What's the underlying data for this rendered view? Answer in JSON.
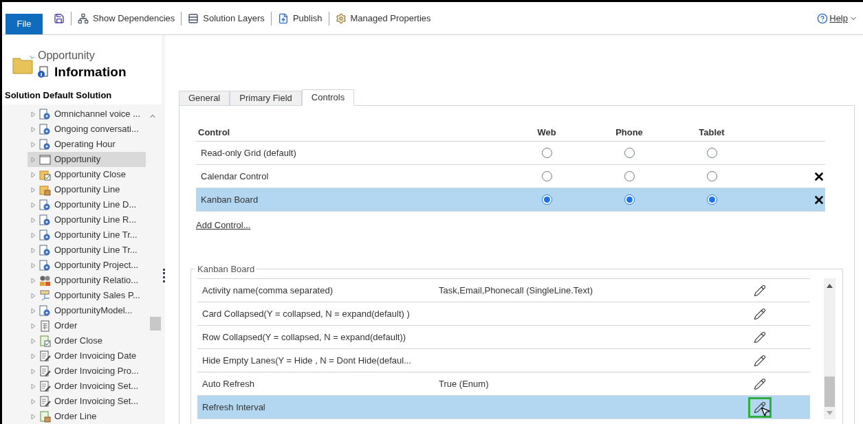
{
  "toolbar": {
    "file_tab": "File",
    "items": [
      {
        "kind": "save"
      },
      {
        "kind": "dependencies",
        "label": "Show Dependencies"
      },
      {
        "kind": "layers",
        "label": "Solution Layers"
      },
      {
        "kind": "publish",
        "label": "Publish"
      },
      {
        "kind": "properties",
        "label": "Managed Properties"
      }
    ],
    "help": "Help"
  },
  "entity_header": {
    "entity": "Opportunity",
    "title": "Information"
  },
  "sidebar": {
    "solution_label": "Solution Default Solution",
    "items": [
      {
        "label": "Omnichannel voice ...",
        "kind": "gear",
        "selected": false
      },
      {
        "label": "Ongoing conversati...",
        "kind": "gear",
        "selected": false
      },
      {
        "label": "Operating Hour",
        "kind": "gear",
        "selected": false
      },
      {
        "label": "Opportunity",
        "kind": "blank",
        "selected": true
      },
      {
        "label": "Opportunity Close",
        "kind": "folder-check",
        "selected": false
      },
      {
        "label": "Opportunity Line",
        "kind": "folder-box",
        "selected": false
      },
      {
        "label": "Opportunity Line D...",
        "kind": "gear",
        "selected": false
      },
      {
        "label": "Opportunity Line R...",
        "kind": "gear",
        "selected": false
      },
      {
        "label": "Opportunity Line Tr...",
        "kind": "gear",
        "selected": false
      },
      {
        "label": "Opportunity Line Tr...",
        "kind": "gear",
        "selected": false
      },
      {
        "label": "Opportunity Project...",
        "kind": "gear",
        "selected": false
      },
      {
        "label": "Opportunity Relatio...",
        "kind": "people",
        "selected": false
      },
      {
        "label": "Opportunity Sales P...",
        "kind": "flow",
        "selected": false
      },
      {
        "label": "OpportunityModel...",
        "kind": "gear",
        "selected": false
      },
      {
        "label": "Order",
        "kind": "doc",
        "selected": false
      },
      {
        "label": "Order Close",
        "kind": "doc-check",
        "selected": false
      },
      {
        "label": "Order Invoicing Date",
        "kind": "doc-edit",
        "selected": false
      },
      {
        "label": "Order Invoicing Pro...",
        "kind": "doc-edit",
        "selected": false
      },
      {
        "label": "Order Invoicing Set...",
        "kind": "doc-edit",
        "selected": false
      },
      {
        "label": "Order Invoicing Set...",
        "kind": "doc-edit",
        "selected": false
      },
      {
        "label": "Order Line",
        "kind": "doc-box",
        "selected": false
      }
    ]
  },
  "tabs": [
    {
      "label": "General",
      "selected": false
    },
    {
      "label": "Primary Field",
      "selected": false
    },
    {
      "label": "Controls",
      "selected": true
    }
  ],
  "controls_table": {
    "columns": [
      "Control",
      "Web",
      "Phone",
      "Tablet"
    ],
    "rows": [
      {
        "name": "Read-only Grid (default)",
        "web": false,
        "phone": false,
        "tablet": false,
        "removable": false,
        "selected": false
      },
      {
        "name": "Calendar Control",
        "web": false,
        "phone": false,
        "tablet": false,
        "removable": true,
        "selected": false
      },
      {
        "name": "Kanban Board",
        "web": true,
        "phone": true,
        "tablet": true,
        "removable": true,
        "selected": true
      }
    ],
    "add_link": "Add Control..."
  },
  "properties": {
    "legend": "Kanban Board",
    "rows": [
      {
        "name": "Activity name(comma separated)",
        "value": "Task,Email,Phonecall (SingleLine.Text)",
        "selected": false
      },
      {
        "name": "Card Collapsed(Y = collapsed, N = expand(default) )",
        "selected": false
      },
      {
        "name": "Row Collapsed(Y = collapsed, N = expand(default))",
        "selected": false
      },
      {
        "name": "Hide Empty Lanes(Y = Hide , N = Dont Hide(defaul...",
        "selected": false
      },
      {
        "name": "Auto Refresh",
        "value": "True (Enum)",
        "selected": false
      },
      {
        "name": "Refresh Interval",
        "selected": true
      }
    ]
  }
}
